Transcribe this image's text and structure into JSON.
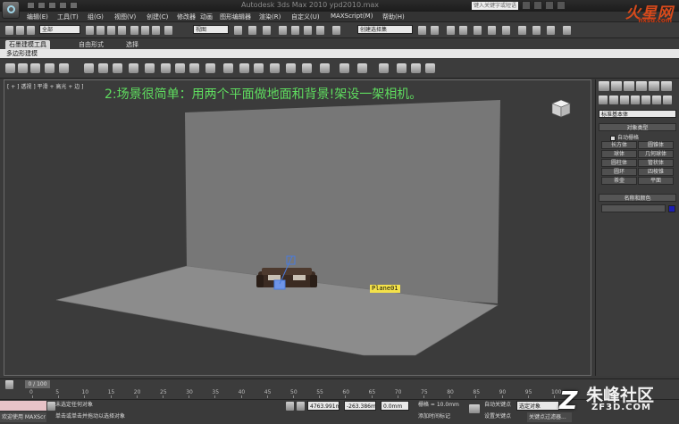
{
  "window": {
    "title": "Autodesk 3ds Max  2010     ypd2010.max",
    "search_placeholder": "键入关键字或短语"
  },
  "watermark_top": {
    "brand": "火星网",
    "url": "hxsd.com"
  },
  "menu": [
    "编辑(E)",
    "工具(T)",
    "组(G)",
    "视图(V)",
    "创建(C)",
    "修改器",
    "动画",
    "图形编辑器",
    "渲染(R)",
    "自定义(U)",
    "MAXScript(M)",
    "帮助(H)"
  ],
  "toolbar": {
    "selection_filter": "全部",
    "coord_system": "视图",
    "named_selection": "创建选择集"
  },
  "ribbon": {
    "tabs": [
      "石墨建模工具",
      "自由形式",
      "选择"
    ],
    "sub_label": "多边形建模"
  },
  "viewport": {
    "label": "[ + ] 透视 ] 平滑 + 高光 + 边 ]",
    "overlay_text": "2:场景很简单：用两个平面做地面和背景!架设一架相机。",
    "object_label": "Plane01"
  },
  "command_panel": {
    "category": "标准基本体",
    "rollout_object_type": "对象类型",
    "autogrid": "自动栅格",
    "buttons": [
      "长方体",
      "圆锥体",
      "球体",
      "几何球体",
      "圆柱体",
      "管状体",
      "圆环",
      "四棱锥",
      "茶壶",
      "平面"
    ],
    "rollout_name_color": "名称和颜色",
    "color": "#1d1fb4"
  },
  "timeline": {
    "frame_readout": "0 / 100",
    "ticks": [
      "0",
      "5",
      "10",
      "15",
      "20",
      "25",
      "30",
      "35",
      "40",
      "45",
      "50",
      "55",
      "60",
      "65",
      "70",
      "75",
      "80",
      "85",
      "90",
      "95",
      "100"
    ]
  },
  "status": {
    "welcome": "欢迎使用 MAXScr",
    "selection_status": "未选定任何对象",
    "prompt": "单击或单击并拖动以选择对象",
    "x_value": "4763.991m",
    "y_value": "-263.386m",
    "z_value": "0.0mm",
    "grid": "栅格 = 10.0mm",
    "auto_key": "自动关键点",
    "selected_set": "选定对象",
    "set_key": "设置关键点",
    "key_filters": "关键点过滤器...",
    "add_time_tag": "添加时间标记"
  },
  "watermark_bottom": {
    "cn": "朱峰社区",
    "en": "ZF3D.COM"
  }
}
